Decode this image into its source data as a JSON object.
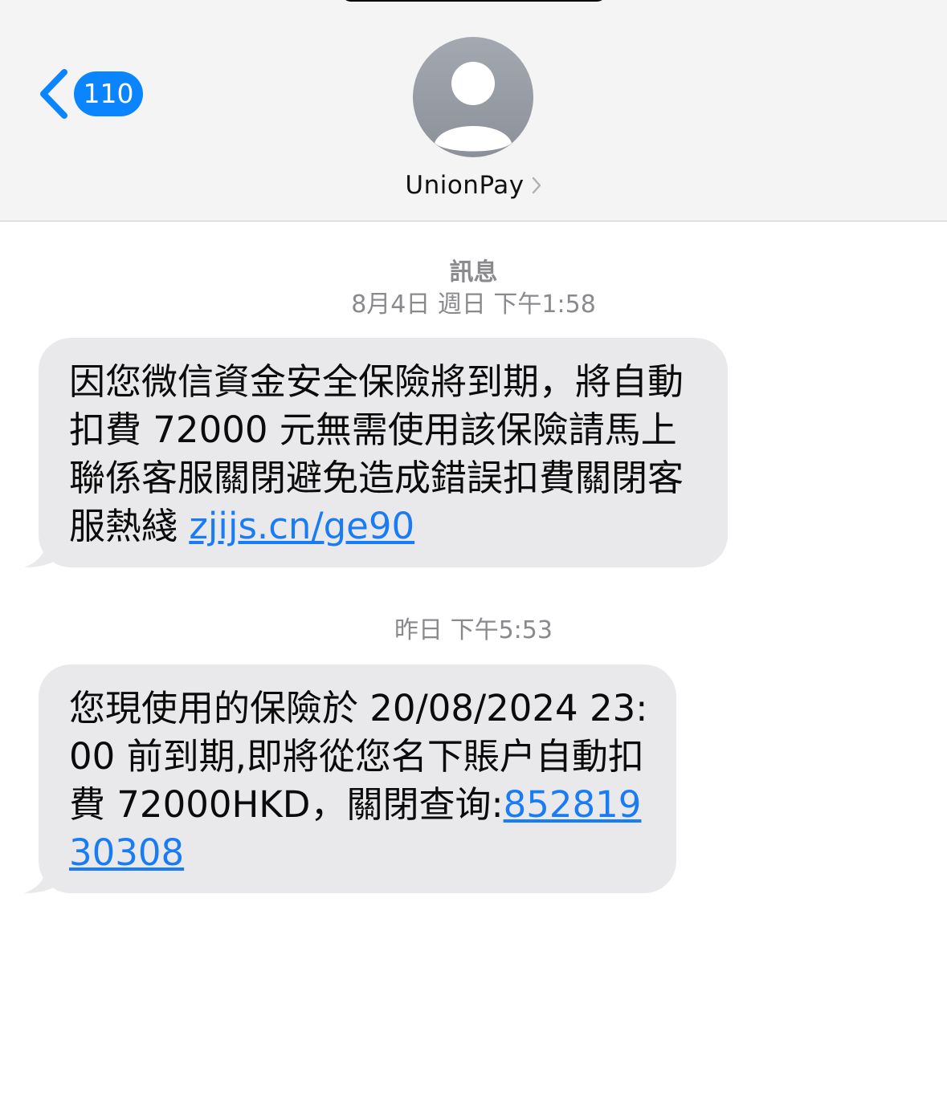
{
  "header": {
    "back_count": "110",
    "contact_name": "UnionPay"
  },
  "thread": {
    "kind_label": "訊息",
    "messages": [
      {
        "timestamp": "8月4日 週日 下午1:58",
        "text": "因您微信資金安全保險將到期，將自動扣費 72000 元無需使用該保險請馬上聯係客服關閉避免造成錯誤扣費關閉客服熱綫 ",
        "link": "zjijs.cn/ge90"
      },
      {
        "timestamp": "昨日 下午5:53",
        "text": "您現使用的保險於 20/08/2024 23:00 前到期,即將從您名下賬户自動扣費 72000HKD，關閉查询:",
        "link": "85281930308"
      }
    ]
  },
  "colors": {
    "accent": "#0a84ff",
    "link": "#1a7cf5",
    "bubble": "#e9e9eb",
    "header_bg": "#f4f4f4",
    "meta_text": "#8a8a8e"
  },
  "icons": {
    "back": "chevron-left-icon",
    "avatar": "person-silhouette-icon",
    "contact_detail": "chevron-right-icon"
  }
}
